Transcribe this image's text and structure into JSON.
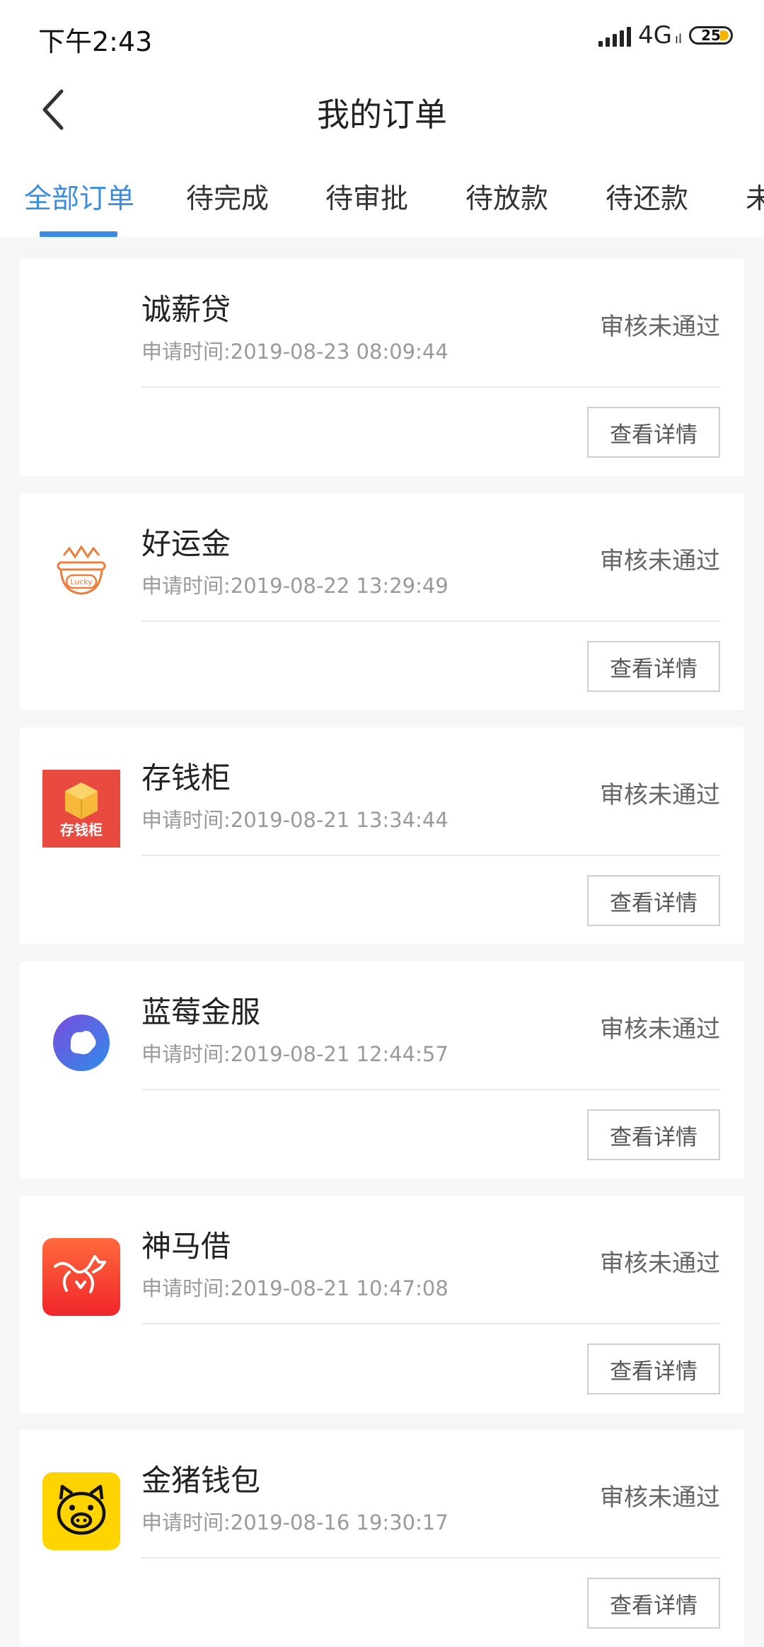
{
  "status_bar": {
    "time": "下午2:43",
    "network": "4G",
    "network_sub": "ıl",
    "battery": "25"
  },
  "header": {
    "title": "我的订单"
  },
  "tabs": [
    {
      "label": "全部订单",
      "active": true
    },
    {
      "label": "待完成",
      "active": false
    },
    {
      "label": "待审批",
      "active": false
    },
    {
      "label": "待放款",
      "active": false
    },
    {
      "label": "待还款",
      "active": false
    },
    {
      "label": "未",
      "active": false
    }
  ],
  "orders": [
    {
      "name": "诚薪贷",
      "time": "申请时间:2019-08-23 08:09:44",
      "status": "审核未通过",
      "button": "查看详情",
      "logo": "none"
    },
    {
      "name": "好运金",
      "time": "申请时间:2019-08-22 13:29:49",
      "status": "审核未通过",
      "button": "查看详情",
      "logo": "lucky-pot-icon",
      "logo_text": "Lucky",
      "color": "#ee7d3a"
    },
    {
      "name": "存钱柜",
      "time": "申请时间:2019-08-21 13:34:44",
      "status": "审核未通过",
      "button": "查看详情",
      "logo": "money-cabinet-icon",
      "logo_text": "存钱柜",
      "color": "#e84a3f"
    },
    {
      "name": "蓝莓金服",
      "time": "申请时间:2019-08-21 12:44:57",
      "status": "审核未通过",
      "button": "查看详情",
      "logo": "blueberry-icon",
      "color": "#4b5fe0"
    },
    {
      "name": "神马借",
      "time": "申请时间:2019-08-21 10:47:08",
      "status": "审核未通过",
      "button": "查看详情",
      "logo": "horse-icon",
      "color": "#f4462f"
    },
    {
      "name": "金猪钱包",
      "time": "申请时间:2019-08-16 19:30:17",
      "status": "审核未通过",
      "button": "查看详情",
      "logo": "pig-icon",
      "color": "#ffd400"
    }
  ]
}
